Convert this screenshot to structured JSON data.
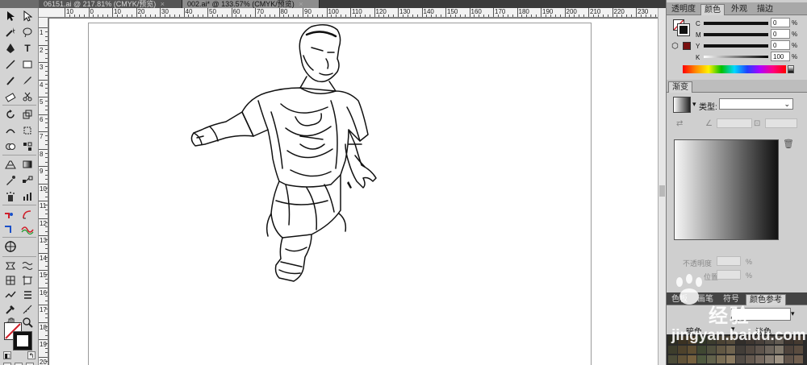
{
  "doc_tabs": [
    {
      "title": "06151.ai @ 217.81% (CMYK/预览)",
      "close": "×",
      "active": false
    },
    {
      "title": "002.ai* @ 133.57% (CMYK/预览)",
      "close": "×",
      "active": true
    }
  ],
  "ruler": {
    "h_labels": [
      "10",
      "0",
      "10",
      "20",
      "30",
      "40",
      "50",
      "60",
      "70",
      "80",
      "90",
      "100",
      "110",
      "120",
      "130",
      "140",
      "150",
      "160",
      "170",
      "180",
      "190",
      "200",
      "210",
      "220",
      "230"
    ],
    "v_labels": [
      "1",
      "2",
      "3",
      "4",
      "5",
      "6",
      "7",
      "8",
      "9",
      "10",
      "11",
      "12",
      "13",
      "14",
      "15",
      "16",
      "17",
      "18",
      "19",
      "20"
    ]
  },
  "tools": {
    "type": "T",
    "slice": "✂"
  },
  "panels": {
    "top_tabs": [
      "透明度",
      "颜色",
      "外观",
      "描边"
    ],
    "active_top_tab": "颜色",
    "color": {
      "sliders": [
        {
          "label": "C",
          "value": "0",
          "unit": "%"
        },
        {
          "label": "M",
          "value": "0",
          "unit": "%"
        },
        {
          "label": "Y",
          "value": "0",
          "unit": "%"
        },
        {
          "label": "K",
          "value": "100",
          "unit": "%"
        }
      ]
    },
    "gradient": {
      "tab": "渐变",
      "type_label": "类型:",
      "type_value": "",
      "opacity_label": "不透明度",
      "location_label": "位置",
      "pct": "%"
    },
    "swatches": {
      "tabs": [
        "色板",
        "画笔",
        "符号",
        "颜色参考"
      ],
      "labels": [
        "暗色",
        "淡色"
      ]
    }
  },
  "watermark": {
    "brand": "经验",
    "url": "jingyan.baidu.com"
  },
  "colors": {
    "accent_red": "#d0202a",
    "canvas": "#ffffff",
    "panel_bg": "#cfcfcf"
  }
}
